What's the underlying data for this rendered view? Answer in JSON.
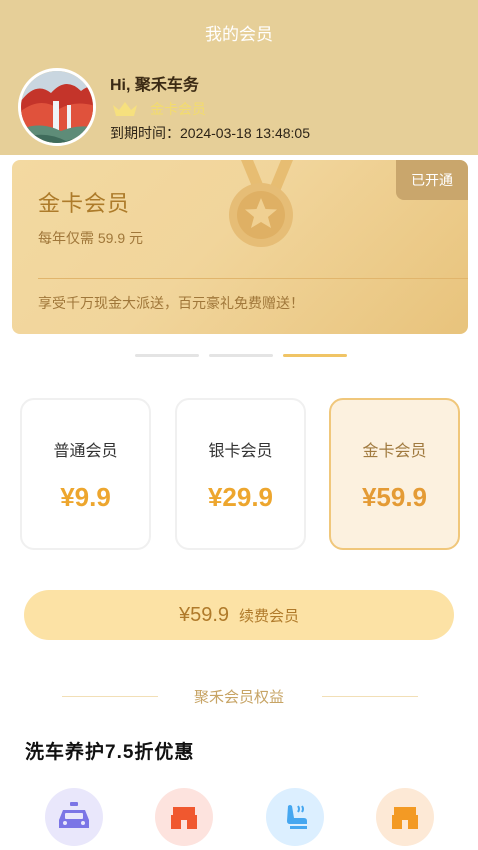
{
  "header": {
    "title": "我的会员",
    "greeting": "Hi, 聚禾车务",
    "level": "金卡会员",
    "expiry": "到期时间：2024-03-18 13:48:05"
  },
  "banner": {
    "title": "金卡会员",
    "price_text": "每年仅需 59.9 元",
    "desc": "享受千万现金大派送，百元豪礼免费赠送！",
    "tag": "已开通"
  },
  "carousel": {
    "total": 3,
    "active": 3
  },
  "plans": [
    {
      "name": "普通会员",
      "price": "¥9.9"
    },
    {
      "name": "银卡会员",
      "price": "¥29.9"
    },
    {
      "name": "金卡会员",
      "price": "¥59.9",
      "selected": true
    }
  ],
  "renew": {
    "price": "¥59.9",
    "label": "续费会员"
  },
  "section": {
    "title": "聚禾会员权益"
  },
  "benefit": {
    "heading": "洗车养护7.5折优惠"
  },
  "benefit_icons": [
    {
      "icon": "car-icon",
      "color": "#7b75e6"
    },
    {
      "icon": "shop-icon",
      "color": "#f0582f"
    },
    {
      "icon": "seat-icon",
      "color": "#46a7f0"
    },
    {
      "icon": "store-icon",
      "color": "#f39a24"
    }
  ],
  "colors": {
    "header_bg": "#e6cf98",
    "accent": "#eda62e",
    "gold_text": "#ad7b2a"
  }
}
